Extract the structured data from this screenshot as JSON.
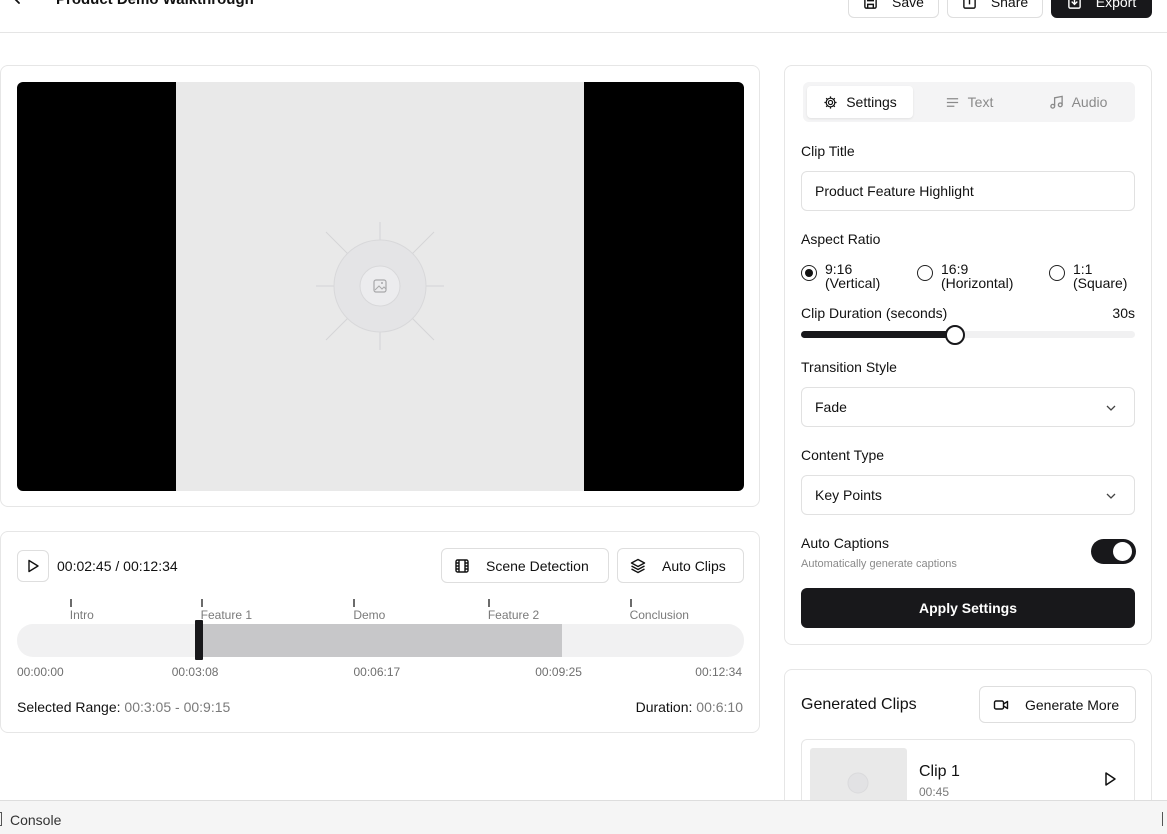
{
  "header": {
    "title": "Product Demo Walkthrough",
    "save_label": "Save",
    "share_label": "Share",
    "export_label": "Export"
  },
  "player": {
    "current_time": "00:02:45",
    "total_time": "00:12:34",
    "time_separator": "/",
    "scene_detection_label": "Scene Detection",
    "auto_clips_label": "Auto Clips"
  },
  "timeline": {
    "markers": [
      {
        "label": "Intro",
        "position": 0.085
      },
      {
        "label": "Feature 1",
        "position": 0.265
      },
      {
        "label": "Demo",
        "position": 0.475
      },
      {
        "label": "Feature 2",
        "position": 0.66
      },
      {
        "label": "Conclusion",
        "position": 0.855
      }
    ],
    "selection": {
      "start": 0.25,
      "end": 0.75
    },
    "playhead": 0.25,
    "time_labels": [
      "00:00:00",
      "00:03:08",
      "00:06:17",
      "00:09:25",
      "00:12:34"
    ],
    "selected_range_label": "Selected Range:",
    "selected_range_value": "00:3:05 - 00:9:15",
    "duration_label": "Duration:",
    "duration_value": "00:6:10"
  },
  "settings": {
    "tabs": [
      {
        "label": "Settings",
        "icon": "gear-icon",
        "active": true
      },
      {
        "label": "Text",
        "icon": "text-lines-icon",
        "active": false
      },
      {
        "label": "Audio",
        "icon": "music-note-icon",
        "active": false
      }
    ],
    "clip_title_label": "Clip Title",
    "clip_title_value": "Product Feature Highlight",
    "aspect_ratio_label": "Aspect Ratio",
    "aspect_options": [
      {
        "ratio": "9:16",
        "desc": "(Vertical)",
        "selected": true
      },
      {
        "ratio": "16:9",
        "desc": "(Horizontal)",
        "selected": false
      },
      {
        "ratio": "1:1",
        "desc": "(Square)",
        "selected": false
      }
    ],
    "clip_duration_label": "Clip Duration (seconds)",
    "clip_duration_value": "30s",
    "clip_duration_fraction": 0.46,
    "transition_label": "Transition Style",
    "transition_value": "Fade",
    "content_type_label": "Content Type",
    "content_type_value": "Key Points",
    "auto_captions_label": "Auto Captions",
    "auto_captions_sub": "Automatically generate captions",
    "auto_captions_on": true,
    "apply_label": "Apply Settings"
  },
  "clips": {
    "title": "Generated Clips",
    "generate_more_label": "Generate More",
    "items": [
      {
        "name": "Clip 1",
        "duration": "00:45"
      }
    ]
  },
  "console": {
    "label": "Console"
  },
  "colors": {
    "accent": "#18181b",
    "frame_bg": "#e9e9e9",
    "border": "#e6e6e6"
  }
}
